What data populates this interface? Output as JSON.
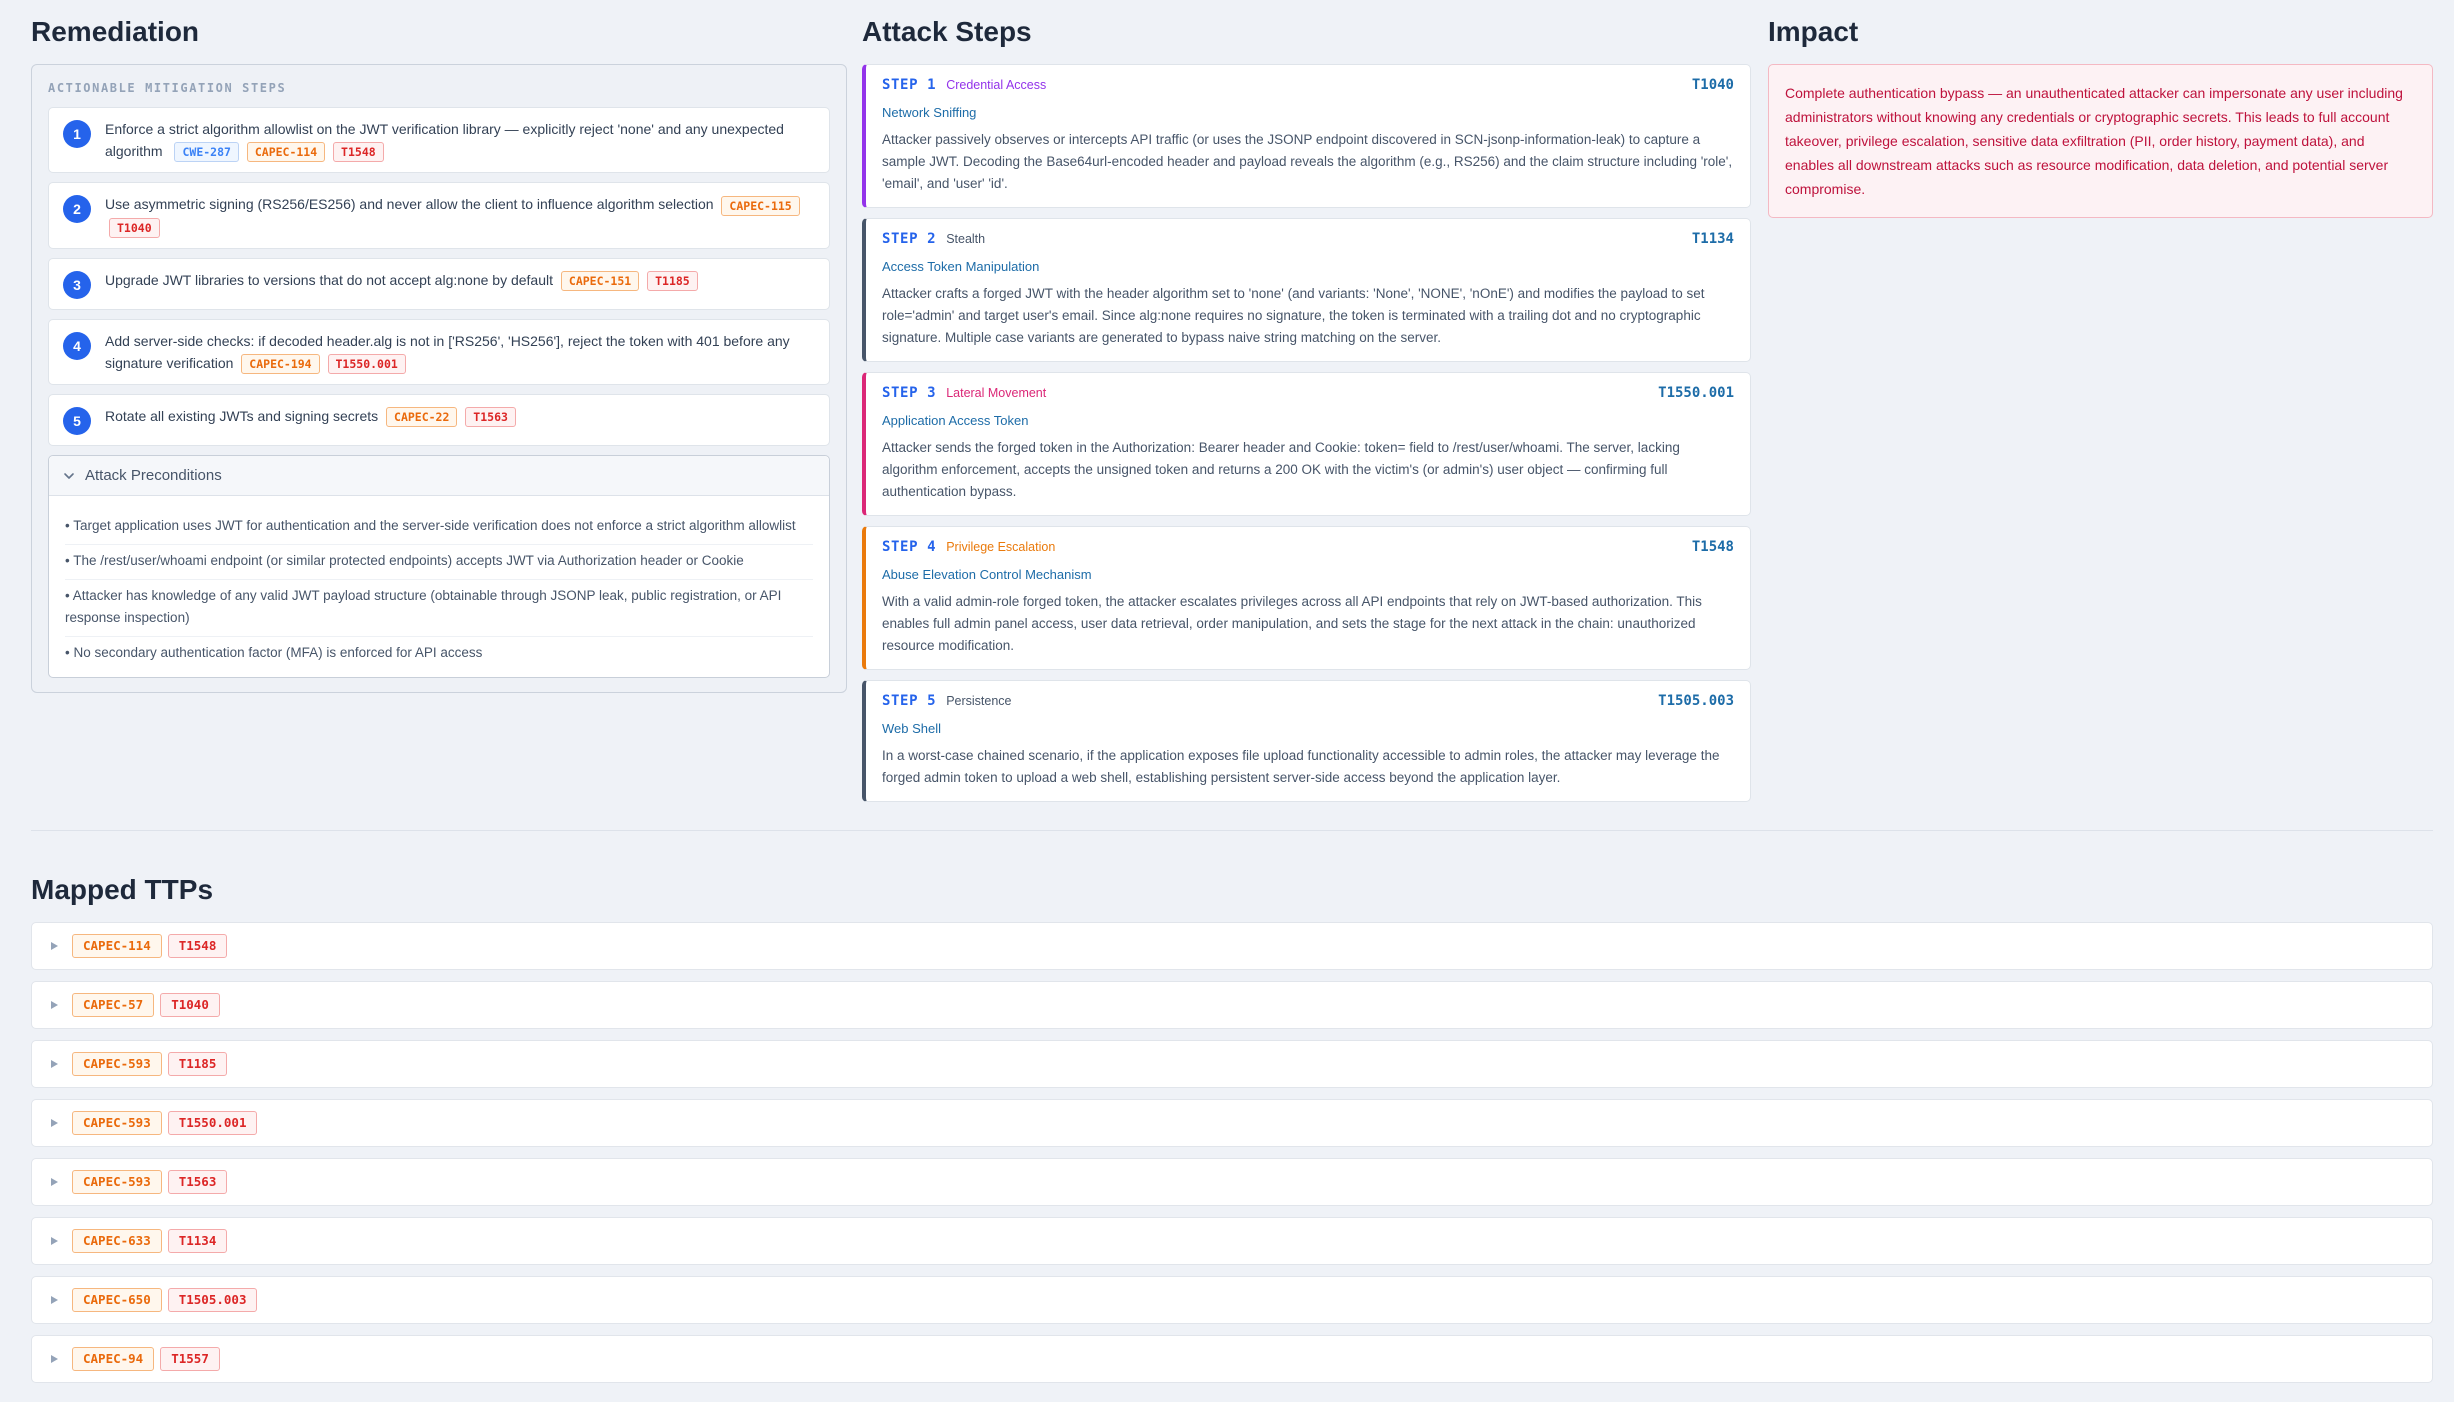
{
  "remediation": {
    "title": "Remediation",
    "heading": "ACTIONABLE MITIGATION STEPS",
    "steps": [
      {
        "num": "1",
        "text": "Enforce a strict algorithm allowlist on the JWT verification library — explicitly reject 'none' and any unexpected algorithm",
        "tags": [
          {
            "type": "cwe",
            "label": "CWE-287"
          },
          {
            "type": "capec",
            "label": "CAPEC-114"
          },
          {
            "type": "t",
            "label": "T1548"
          }
        ]
      },
      {
        "num": "2",
        "text": "Use asymmetric signing (RS256/ES256) and never allow the client to influence algorithm selection",
        "tags": [
          {
            "type": "capec",
            "label": "CAPEC-115"
          },
          {
            "type": "t",
            "label": "T1040"
          }
        ]
      },
      {
        "num": "3",
        "text": "Upgrade JWT libraries to versions that do not accept alg:none by default",
        "tags": [
          {
            "type": "capec",
            "label": "CAPEC-151"
          },
          {
            "type": "t",
            "label": "T1185"
          }
        ]
      },
      {
        "num": "4",
        "text": "Add server-side checks: if decoded header.alg is not in ['RS256', 'HS256'], reject the token with 401 before any signature verification",
        "tags": [
          {
            "type": "capec",
            "label": "CAPEC-194"
          },
          {
            "type": "t",
            "label": "T1550.001"
          }
        ]
      },
      {
        "num": "5",
        "text": "Rotate all existing JWTs and signing secrets",
        "tags": [
          {
            "type": "capec",
            "label": "CAPEC-22"
          },
          {
            "type": "t",
            "label": "T1563"
          }
        ]
      }
    ],
    "preconditions": {
      "title": "Attack Preconditions",
      "items": [
        "• Target application uses JWT for authentication and the server-side verification does not enforce a strict algorithm allowlist",
        "• The /rest/user/whoami endpoint (or similar protected endpoints) accepts JWT via Authorization header or Cookie",
        "• Attacker has knowledge of any valid JWT payload structure (obtainable through JSONP leak, public registration, or API response inspection)",
        "• No secondary authentication factor (MFA) is enforced for API access"
      ]
    }
  },
  "attack_steps": {
    "title": "Attack Steps",
    "steps": [
      {
        "label": "STEP 1",
        "tactic": "Credential Access",
        "color": "#9333ea",
        "technique": "T1040",
        "name": "Network Sniffing",
        "desc": "Attacker passively observes or intercepts API traffic (or uses the JSONP endpoint discovered in SCN-jsonp-information-leak) to capture a sample JWT. Decoding the Base64url-encoded header and payload reveals the algorithm (e.g., RS256) and the claim structure including 'role', 'email', and 'user' 'id'."
      },
      {
        "label": "STEP 2",
        "tactic": "Stealth",
        "color": "#475569",
        "technique": "T1134",
        "name": "Access Token Manipulation",
        "desc": "Attacker crafts a forged JWT with the header algorithm set to 'none' (and variants: 'None', 'NONE', 'nOnE') and modifies the payload to set role='admin' and target user's email. Since alg:none requires no signature, the token is terminated with a trailing dot and no cryptographic signature. Multiple case variants are generated to bypass naive string matching on the server."
      },
      {
        "label": "STEP 3",
        "tactic": "Lateral Movement",
        "color": "#db2777",
        "technique": "T1550.001",
        "name": "Application Access Token",
        "desc": "Attacker sends the forged token in the Authorization: Bearer header and Cookie: token= field to /rest/user/whoami. The server, lacking algorithm enforcement, accepts the unsigned token and returns a 200 OK with the victim's (or admin's) user object — confirming full authentication bypass."
      },
      {
        "label": "STEP 4",
        "tactic": "Privilege Escalation",
        "color": "#ea7a0c",
        "technique": "T1548",
        "name": "Abuse Elevation Control Mechanism",
        "desc": "With a valid admin-role forged token, the attacker escalates privileges across all API endpoints that rely on JWT-based authorization. This enables full admin panel access, user data retrieval, order manipulation, and sets the stage for the next attack in the chain: unauthorized resource modification."
      },
      {
        "label": "STEP 5",
        "tactic": "Persistence",
        "color": "#475569",
        "technique": "T1505.003",
        "name": "Web Shell",
        "desc": "In a worst-case chained scenario, if the application exposes file upload functionality accessible to admin roles, the attacker may leverage the forged admin token to upload a web shell, establishing persistent server-side access beyond the application layer."
      }
    ]
  },
  "impact": {
    "title": "Impact",
    "text": "Complete authentication bypass — an unauthenticated attacker can impersonate any user including administrators without knowing any credentials or cryptographic secrets. This leads to full account takeover, privilege escalation, sensitive data exfiltration (PII, order history, payment data), and enables all downstream attacks such as resource modification, data deletion, and potential server compromise."
  },
  "mapped_ttps": {
    "title": "Mapped TTPs",
    "rows": [
      {
        "capec": "CAPEC-114",
        "t": "T1548"
      },
      {
        "capec": "CAPEC-57",
        "t": "T1040"
      },
      {
        "capec": "CAPEC-593",
        "t": "T1185"
      },
      {
        "capec": "CAPEC-593",
        "t": "T1550.001"
      },
      {
        "capec": "CAPEC-593",
        "t": "T1563"
      },
      {
        "capec": "CAPEC-633",
        "t": "T1134"
      },
      {
        "capec": "CAPEC-650",
        "t": "T1505.003"
      },
      {
        "capec": "CAPEC-94",
        "t": "T1557"
      }
    ]
  },
  "colors": {
    "step_number_bg": "#2563eb",
    "capec_tag": "#ea6a0c",
    "technique_tag": "#dc2626",
    "cwe_tag": "#3b82f6",
    "impact_text": "#be123c"
  },
  "icons": {
    "precondition_toggle": "chevron-down-icon",
    "ttp_row_toggle": "caret-right-icon"
  }
}
